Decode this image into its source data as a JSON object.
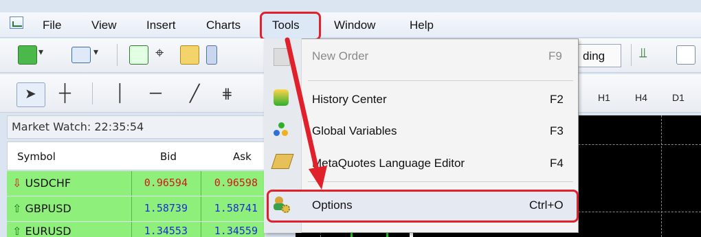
{
  "menubar": {
    "items": [
      "File",
      "View",
      "Insert",
      "Charts",
      "Tools",
      "Window",
      "Help"
    ]
  },
  "toolbar": {
    "partial_button_label": "ding",
    "timeframes": [
      "H1",
      "H4",
      "D1"
    ]
  },
  "market_watch": {
    "title": "Market Watch: 22:35:54",
    "columns": [
      "Symbol",
      "Bid",
      "Ask"
    ],
    "rows": [
      {
        "symbol": "USDCHF",
        "bid": "0.96594",
        "ask": "0.96598",
        "direction": "down"
      },
      {
        "symbol": "GBPUSD",
        "bid": "1.58739",
        "ask": "1.58741",
        "direction": "up"
      },
      {
        "symbol": "EURUSD",
        "bid": "1.34553",
        "ask": "1.34559",
        "direction": "up"
      }
    ]
  },
  "tools_menu": {
    "items": [
      {
        "label": "New Order",
        "shortcut": "F9",
        "enabled": false,
        "icon": "new-order-icon"
      },
      {
        "label": "History Center",
        "shortcut": "F2",
        "enabled": true,
        "icon": "history-center-icon"
      },
      {
        "label": "Global Variables",
        "shortcut": "F3",
        "enabled": true,
        "icon": "global-variables-icon"
      },
      {
        "label": "MetaQuotes Language Editor",
        "shortcut": "F4",
        "enabled": true,
        "icon": "metaeditor-icon"
      },
      {
        "label": "Options",
        "shortcut": "Ctrl+O",
        "enabled": true,
        "icon": "options-gear-icon"
      }
    ]
  },
  "colors": {
    "highlight_red": "#e0202a",
    "row_green": "#8ef07a",
    "down_red": "#d01818",
    "up_blue": "#1a2ed0"
  }
}
